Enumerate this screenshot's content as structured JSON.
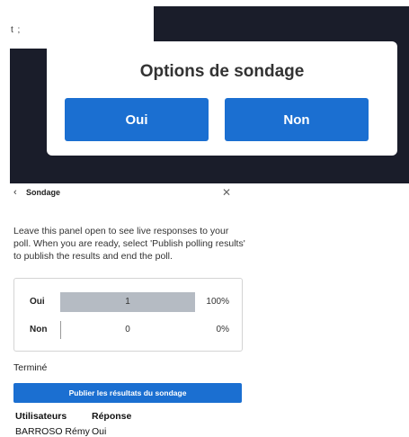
{
  "presentation": {
    "stray_text": "t ;",
    "poll_title": "Options de sondage",
    "options": [
      "Oui",
      "Non"
    ]
  },
  "panel": {
    "back_icon": "chevron-left-icon",
    "title": "Sondage",
    "close_icon": "close-icon",
    "info": "Leave this panel open to see live responses to your poll. When you are ready, select 'Publish polling results' to publish the results and end the poll.",
    "results": [
      {
        "label": "Oui",
        "count": "1",
        "percent": "100%",
        "fraction": 1.0
      },
      {
        "label": "Non",
        "count": "0",
        "percent": "0%",
        "fraction": 0.0
      }
    ],
    "status": "Terminé",
    "publish_label": "Publier les résultats du sondage",
    "table": {
      "headers": [
        "Utilisateurs",
        "Réponse"
      ],
      "rows": [
        [
          "BARROSO Rémy",
          "Oui"
        ]
      ]
    }
  },
  "colors": {
    "accent": "#1b6fd1",
    "dark_background": "#1a1d2a",
    "bar_fill": "#b5bbc3"
  }
}
